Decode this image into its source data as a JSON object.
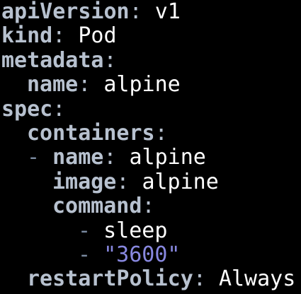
{
  "editor": {
    "lines": [
      {
        "key": "apiVersion",
        "value": "v1"
      },
      {
        "key": "kind",
        "value": "Pod"
      },
      {
        "key": "metadata",
        "value": ""
      },
      {
        "key": "name",
        "value": "alpine"
      },
      {
        "key": "spec",
        "value": ""
      },
      {
        "key": "containers",
        "value": ""
      },
      {
        "dash": "-",
        "key": "name",
        "value": "alpine"
      },
      {
        "key": "image",
        "value": "alpine"
      },
      {
        "key": "command",
        "value": ""
      },
      {
        "dash": "-",
        "value": "sleep"
      },
      {
        "dash": "-",
        "value": "\"3600\""
      },
      {
        "key": "restartPolicy",
        "value": "Always"
      }
    ],
    "colors": {
      "background": "#000000",
      "key": "#b7c1cf",
      "value": "#ffffff",
      "dash": "#7a8aa0",
      "string": "#8888e0"
    }
  }
}
